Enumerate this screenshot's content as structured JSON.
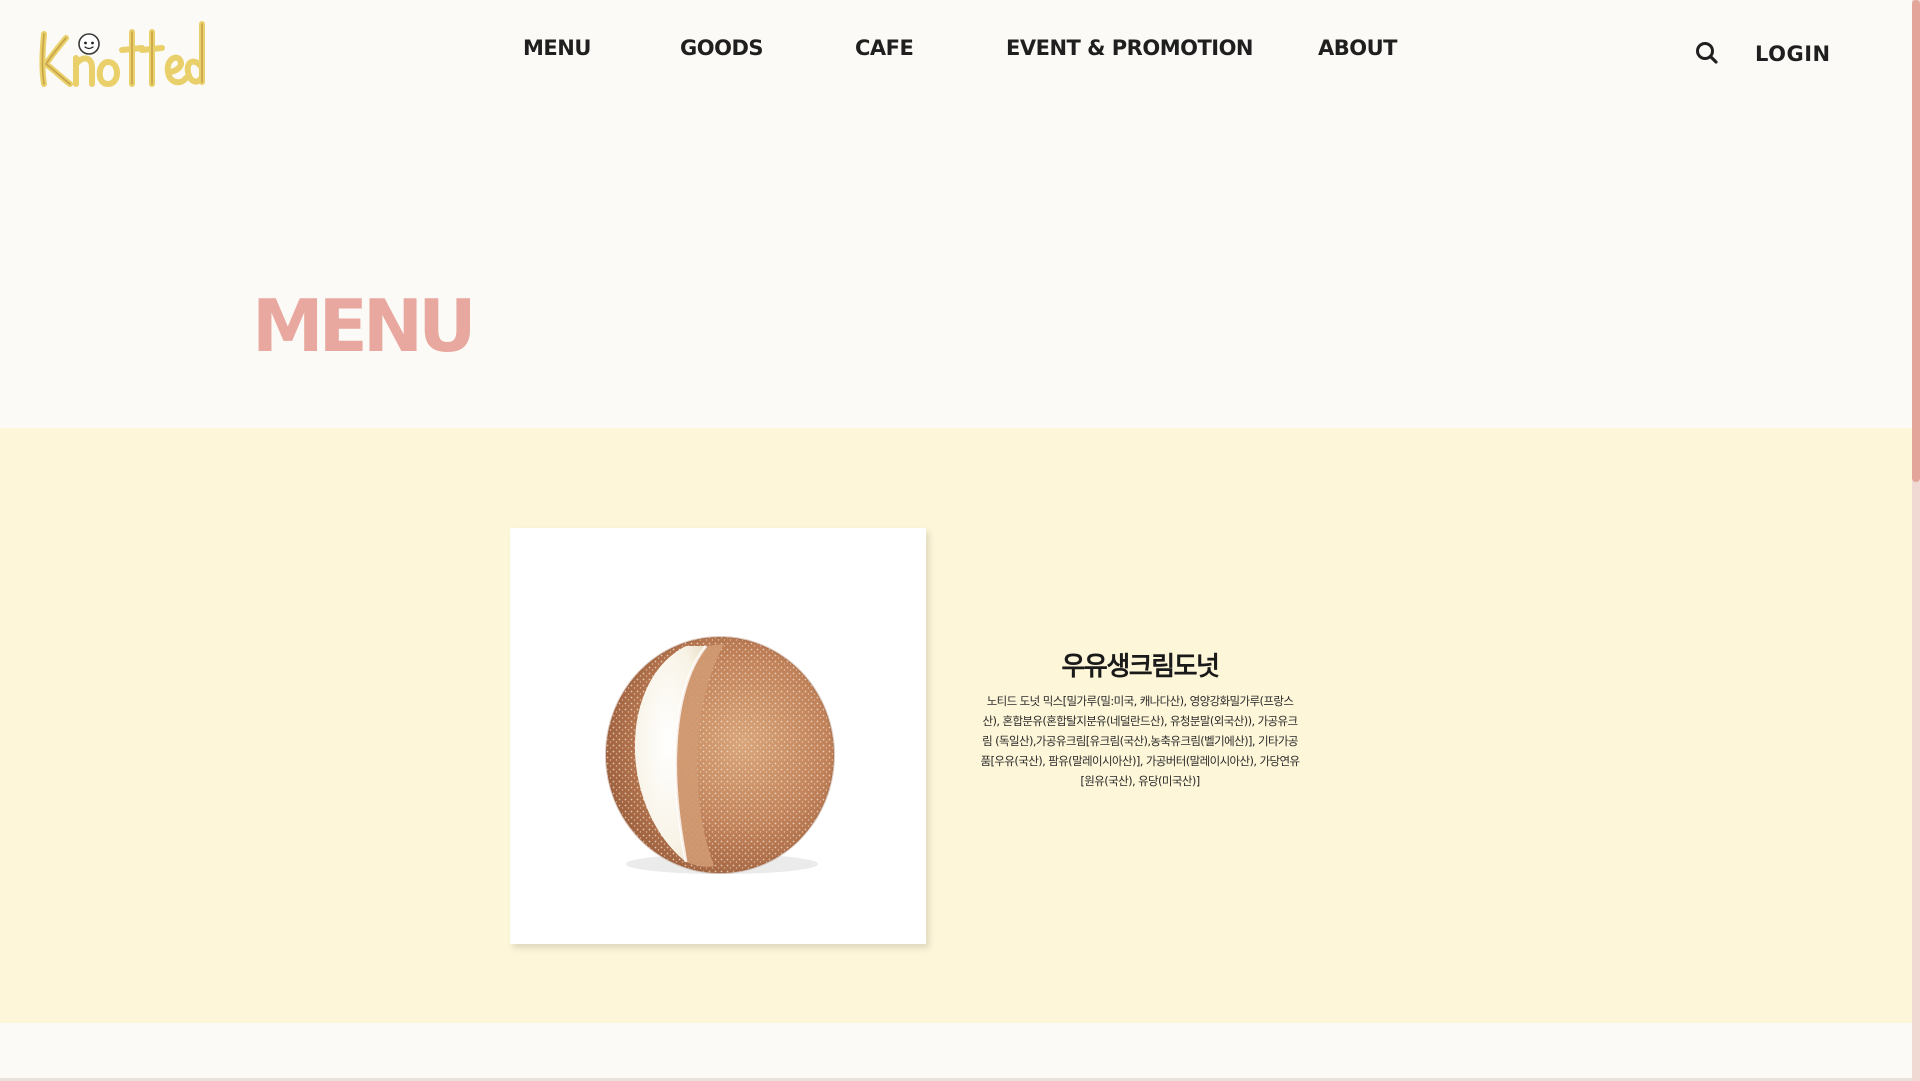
{
  "header": {
    "logo_text": "Knotted",
    "nav": [
      {
        "label": "MENU"
      },
      {
        "label": "GOODS"
      },
      {
        "label": "CAFE"
      },
      {
        "label": "EVENT & PROMOTION"
      },
      {
        "label": "ABOUT"
      }
    ],
    "search_icon": "search-icon",
    "login_label": "LOGIN"
  },
  "page": {
    "title": "MENU"
  },
  "product": {
    "name": "우유생크림도넛",
    "description": "노티드 도넛 믹스[밀가루(밀:미국, 캐나다산), 영양강화밀가루(프랑스산), 혼합분유(혼합탈지분유(네덜란드산), 유청분말(외국산)), 가공유크림 (독일산),가공유크림[유크림(국산),농축유크림(벨기에산)], 기타가공품[우유(국산), 팜유(말레이시아산)], 가공버터(말레이시아산), 가당연유[원유(국산), 유당(미국산)]"
  },
  "colors": {
    "accent_pink": "#e8a89f",
    "band_yellow": "#fdf6d9",
    "background": "#fcfaf6",
    "logo_yellow": "#f3df8a"
  }
}
